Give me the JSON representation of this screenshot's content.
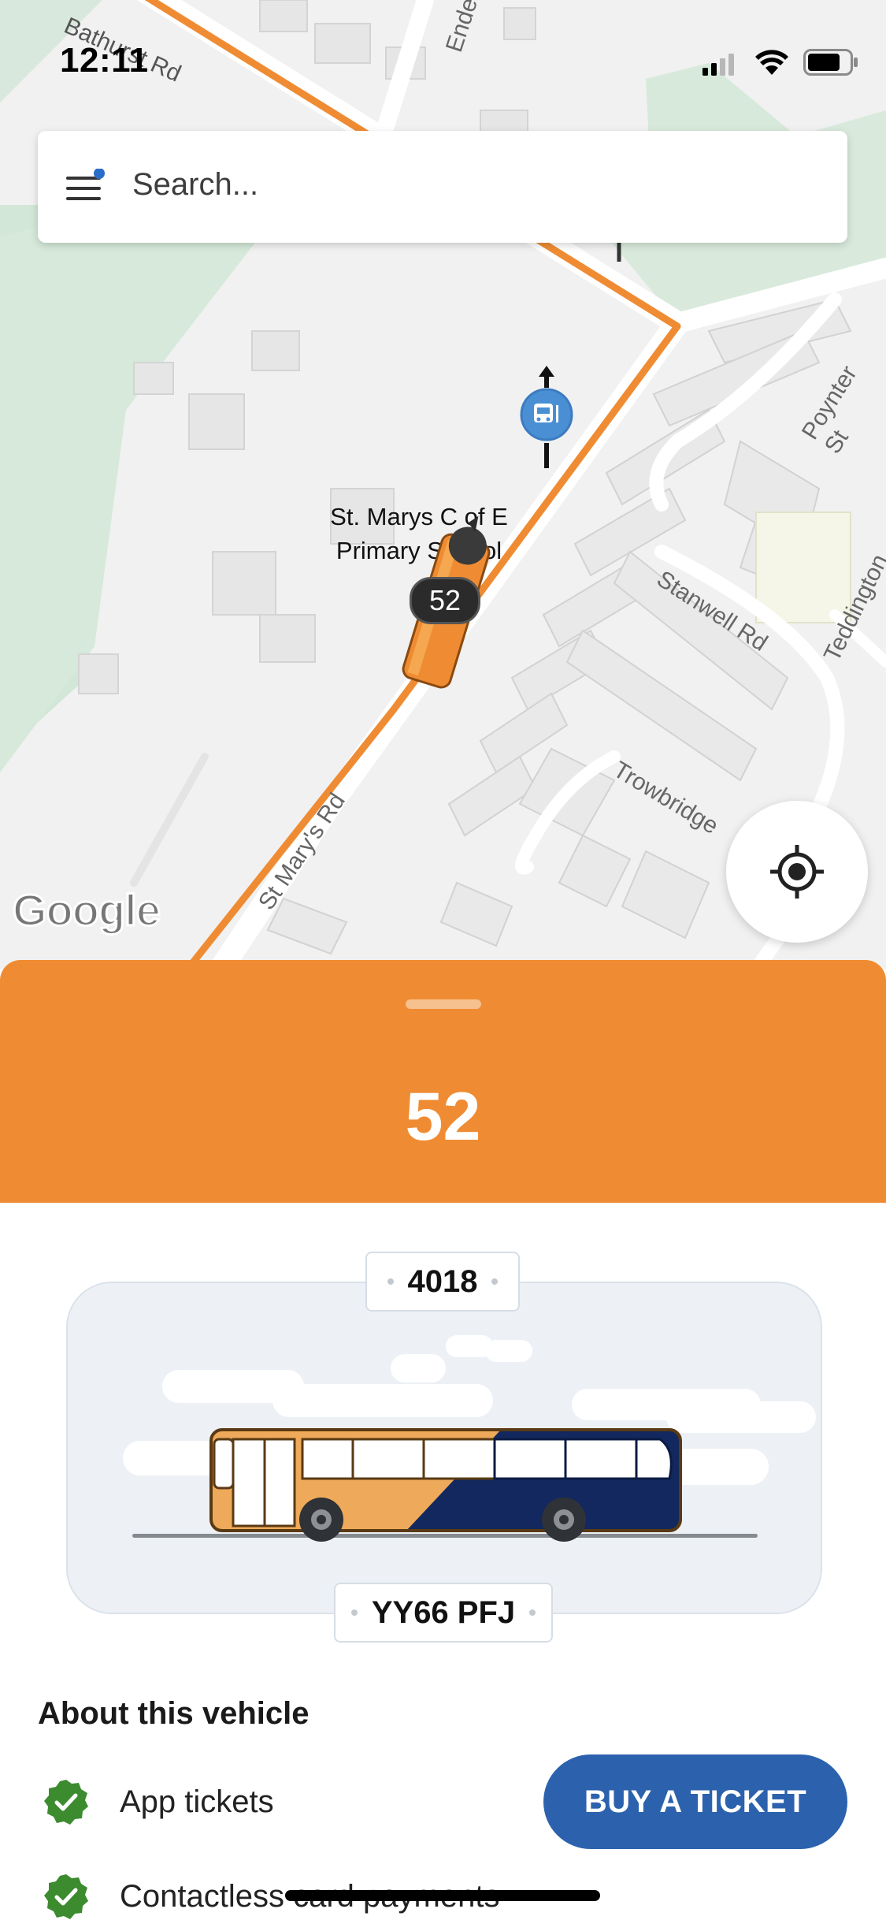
{
  "status_bar": {
    "time": "12:11"
  },
  "search": {
    "placeholder": "Search..."
  },
  "map": {
    "street_labels": [
      "Bathurst Rd",
      "Enderby",
      "Poynter St",
      "Stanwell Rd",
      "Teddington",
      "Trowbridge",
      "St Mary's Rd"
    ],
    "poi_label_line1": "St. Marys C of E",
    "poi_label_line2": "Primary School",
    "bus_marker_label": "52",
    "logo_text": "Google"
  },
  "route": {
    "number": "52"
  },
  "vehicle": {
    "fleet_number": "4018",
    "registration": "YY66 PFJ"
  },
  "about": {
    "title": "About this vehicle",
    "features": [
      "App tickets",
      "Contactless card payments"
    ]
  },
  "actions": {
    "buy_ticket_label": "BUY A TICKET"
  },
  "colors": {
    "accent": "#ef8c33",
    "primary_button": "#2c62ad",
    "check": "#3c8b2f",
    "bus_navy": "#12285e",
    "bus_orange": "#eeaa5a"
  },
  "icons": [
    "menu-icon",
    "signal-icon",
    "wifi-icon",
    "battery-icon",
    "bus-stop-icon",
    "locate-icon",
    "check-icon"
  ]
}
